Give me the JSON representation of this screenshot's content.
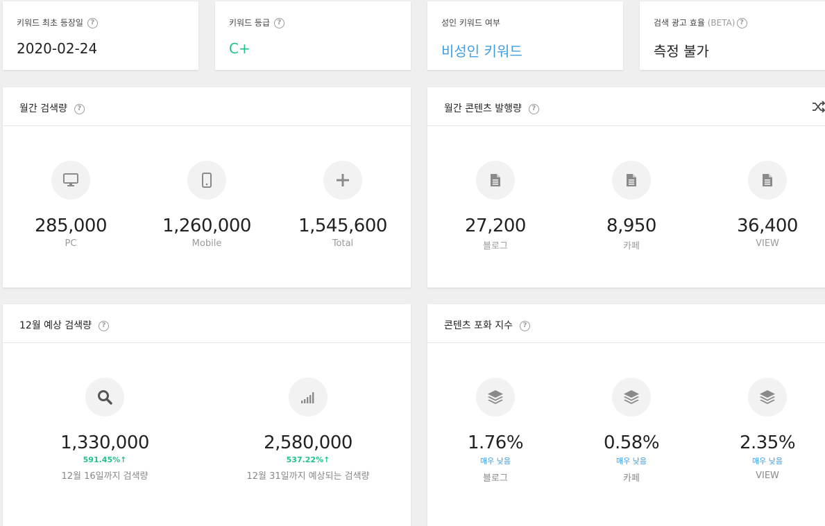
{
  "top_stats": [
    {
      "label": "키워드 최초 등장일",
      "value": "2020-02-24"
    },
    {
      "label": "키워드 등급",
      "value": "C+"
    },
    {
      "label": "성인 키워드 여부",
      "value": "비성인 키워드"
    },
    {
      "label": "검색 광고 효율",
      "label_suffix": "(BETA)",
      "value": "측정 불가"
    }
  ],
  "help_glyph": "?",
  "monthly_search": {
    "title": "월간 검색량",
    "items": [
      {
        "value": "285,000",
        "label": "PC",
        "icon": "monitor-icon"
      },
      {
        "value": "1,260,000",
        "label": "Mobile",
        "icon": "mobile-icon"
      },
      {
        "value": "1,545,600",
        "label": "Total",
        "icon": "plus-icon"
      }
    ]
  },
  "monthly_content": {
    "title": "월간 콘텐츠 발행량",
    "items": [
      {
        "value": "27,200",
        "label": "블로그",
        "icon": "document-icon"
      },
      {
        "value": "8,950",
        "label": "카페",
        "icon": "document-icon"
      },
      {
        "value": "36,400",
        "label": "VIEW",
        "icon": "document-icon"
      }
    ]
  },
  "forecast": {
    "title": "12월 예상 검색량",
    "items": [
      {
        "value": "1,330,000",
        "change": "591.45%↑",
        "label": "12월 16일까지 검색량",
        "icon": "search-icon"
      },
      {
        "value": "2,580,000",
        "change": "537.22%↑",
        "label": "12월 31일까지 예상되는 검색량",
        "icon": "signal-bars-icon"
      }
    ]
  },
  "saturation": {
    "title": "콘텐츠 포화 지수",
    "items": [
      {
        "value": "1.76%",
        "level": "매우 낮음",
        "label": "블로그",
        "icon": "layers-icon"
      },
      {
        "value": "0.58%",
        "level": "매우 낮음",
        "label": "카페",
        "icon": "layers-icon"
      },
      {
        "value": "2.35%",
        "level": "매우 낮음",
        "label": "VIEW",
        "icon": "layers-icon"
      }
    ]
  },
  "colors": {
    "background": "#efefef",
    "grade_green": "#1fc28e",
    "link_blue": "#3d9ee6",
    "icon_gray": "#8a8a8a"
  }
}
